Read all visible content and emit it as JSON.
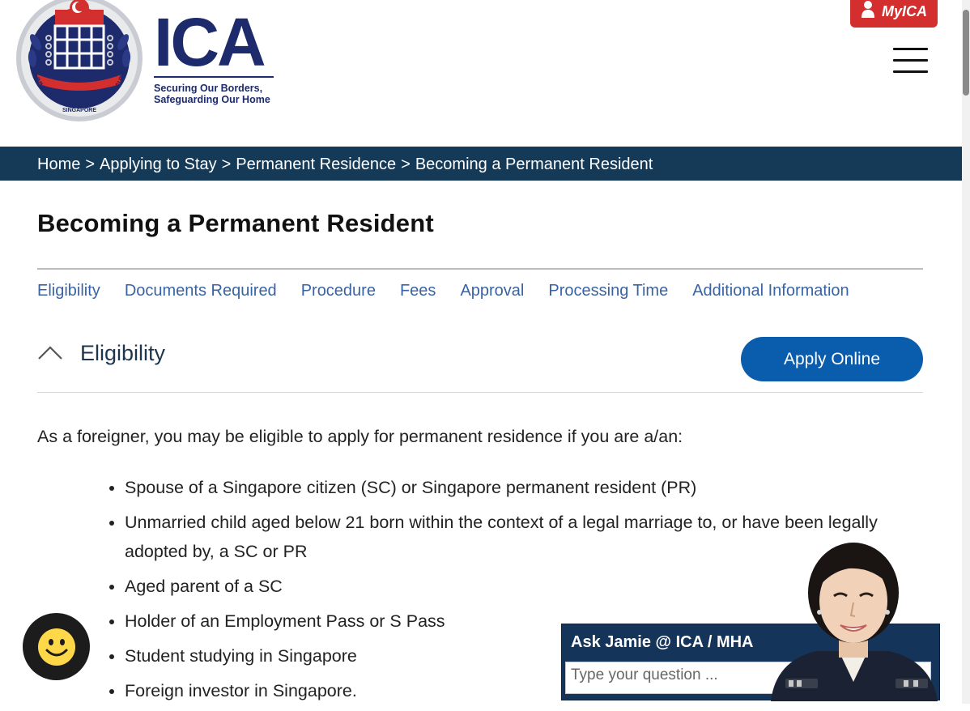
{
  "header": {
    "logo_ring_text": "IMMIGRATION & CHECKPOINTS AUTHORITY",
    "logo_country": "SINGAPORE",
    "wordmark": "ICA",
    "tagline_line1": "Securing Our Borders,",
    "tagline_line2": "Safeguarding Our Home",
    "myica_label": "MyICA",
    "menu_icon": "hamburger-menu-icon",
    "colors": {
      "brand_navy": "#1d2a6b",
      "myica_red": "#d32f2f"
    }
  },
  "breadcrumb": [
    {
      "label": "Home"
    },
    {
      "label": "Applying to Stay"
    },
    {
      "label": "Permanent Residence"
    },
    {
      "label": "Becoming a Permanent Resident"
    }
  ],
  "breadcrumb_separator": ">",
  "page": {
    "title": "Becoming a Permanent Resident",
    "tabs": [
      {
        "label": "Eligibility"
      },
      {
        "label": "Documents Required"
      },
      {
        "label": "Procedure"
      },
      {
        "label": "Fees"
      },
      {
        "label": "Approval"
      },
      {
        "label": "Processing Time"
      },
      {
        "label": "Additional Information"
      }
    ],
    "section": {
      "title": "Eligibility",
      "toggle_icon": "chevron-up-icon",
      "apply_button": "Apply Online",
      "intro": "As a foreigner, you may be eligible to apply for permanent residence if you are a/an:",
      "items": [
        "Spouse of a Singapore citizen (SC) or Singapore permanent resident (PR)",
        "Unmarried child aged below 21 born within the context of a legal marriage to, or have been legally adopted by, a SC or PR",
        "Aged parent of a SC",
        "Holder of an Employment Pass or S Pass",
        "Student studying in Singapore",
        "Foreign investor in Singapore."
      ]
    },
    "colors": {
      "breadcrumb_bg": "#153a57",
      "link": "#3a63a3",
      "button": "#0a5cad"
    }
  },
  "chat": {
    "smiley_icon": "smiley-icon",
    "jamie_title": "Ask Jamie @ ICA / MHA",
    "jamie_placeholder": "Type your question ...",
    "avatar": "jamie-avatar"
  }
}
